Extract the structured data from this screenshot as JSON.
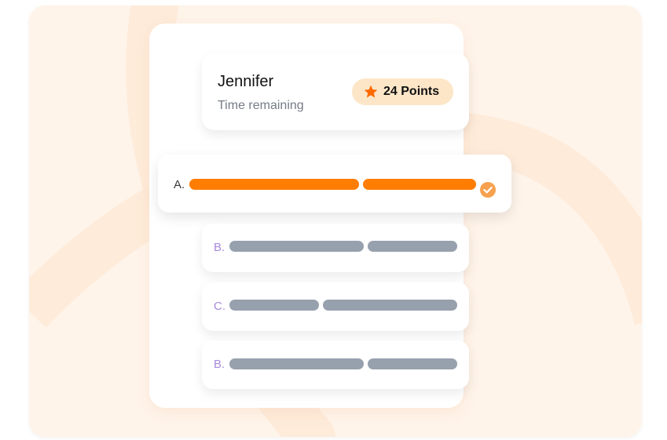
{
  "header": {
    "user_name": "Jennifer",
    "time_label": "Time remaining",
    "points_label": "24 Points",
    "points_icon": "star-icon"
  },
  "answers": [
    {
      "letter": "A.",
      "state": "selected"
    },
    {
      "letter": "B.",
      "state": "unselected"
    },
    {
      "letter": "C.",
      "state": "unselected"
    },
    {
      "letter": "B.",
      "state": "unselected"
    }
  ],
  "colors": {
    "accent": "#ff7d00",
    "background": "#fff4ea",
    "badge": "#fde6c8",
    "option_letter": "#a78bdb",
    "placeholder_bar": "#97a0ad"
  }
}
